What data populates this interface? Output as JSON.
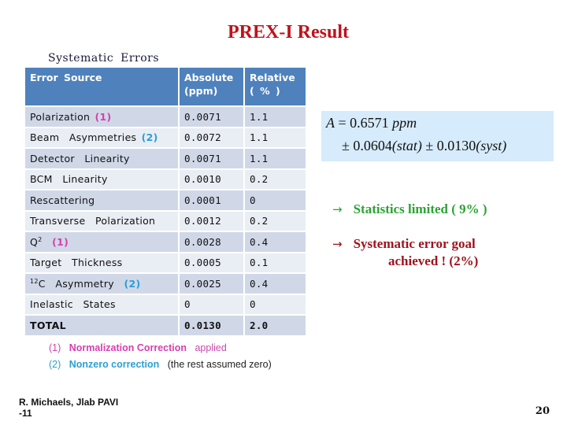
{
  "slide": {
    "title": "PREX-I   Result",
    "subtitle": "Systematic  Errors",
    "page_number": "20",
    "footer_line1": "R. Michaels,  Jlab  PAVI",
    "footer_line2": "-11"
  },
  "table": {
    "headers": {
      "source": "Error  Source",
      "absolute_line1": "Absolute",
      "absolute_line2": "(ppm)",
      "relative_line1": "Relative",
      "relative_line2": "( % )"
    },
    "rows": [
      {
        "source": "Polarization ",
        "note": "(1)",
        "note_type": "1",
        "absolute": "0.0071",
        "relative": "1.1"
      },
      {
        "source": "Beam  Asymmetries ",
        "note": "(2)",
        "note_type": "2",
        "absolute": "0.0072",
        "relative": "1.1"
      },
      {
        "source": "Detector  Linearity",
        "note": "",
        "absolute": "0.0071",
        "relative": "1.1"
      },
      {
        "source": "BCM  Linearity",
        "note": "",
        "absolute": "0.0010",
        "relative": "0.2"
      },
      {
        "source": "Rescattering",
        "note": "",
        "absolute": "0.0001",
        "relative": "0"
      },
      {
        "source": "Transverse  Polarization",
        "note": "",
        "absolute": "0.0012",
        "relative": "0.2"
      },
      {
        "source_prefix": "Q",
        "source_sup": "2",
        "source": "  ",
        "note": "(1)",
        "note_type": "1",
        "absolute": "0.0028",
        "relative": "0.4"
      },
      {
        "source": "Target  Thickness",
        "note": "",
        "absolute": "0.0005",
        "relative": "0.1"
      },
      {
        "source_sup_prefix": "12",
        "source": "C  Asymmetry  ",
        "note": "(2)",
        "note_type": "2",
        "absolute": "0.0025",
        "relative": "0.4"
      },
      {
        "source": "Inelastic  States",
        "note": "",
        "absolute": "0",
        "relative": "0"
      },
      {
        "source": "TOTAL",
        "note": "",
        "absolute": "0.0130",
        "relative": "2.0",
        "bold": true
      }
    ]
  },
  "notes": {
    "n1_marker": "(1)",
    "n1_bold": "Normalization  Correction",
    "n1_rest": "applied",
    "n2_marker": "(2)",
    "n2_bold": "Nonzero correction",
    "n2_rest": "(the rest assumed zero)"
  },
  "formula": {
    "symbol": "A",
    "eq": " =  0.6571 ",
    "unit": "ppm",
    "pm1": "±  0.0604",
    "stat": "(stat)",
    "pm2": " ± 0.0130",
    "syst": "(syst)"
  },
  "bullets": {
    "arrow_icon": "→",
    "b1": "Statistics  limited  ( 9% )",
    "b2_line1": "Systematic error goal",
    "b2_line2": "achieved !   (2%)",
    "b1_color": "#2ca335",
    "b2_color": "#a0121c"
  },
  "colors": {
    "title": "#c0111a",
    "header_bg": "#4f81bd",
    "row_odd": "#d0d8e8",
    "row_even": "#e9edf4",
    "note1": "#d63fae",
    "note2": "#2a9fd6",
    "formula_bg": "#d6ebfb"
  }
}
